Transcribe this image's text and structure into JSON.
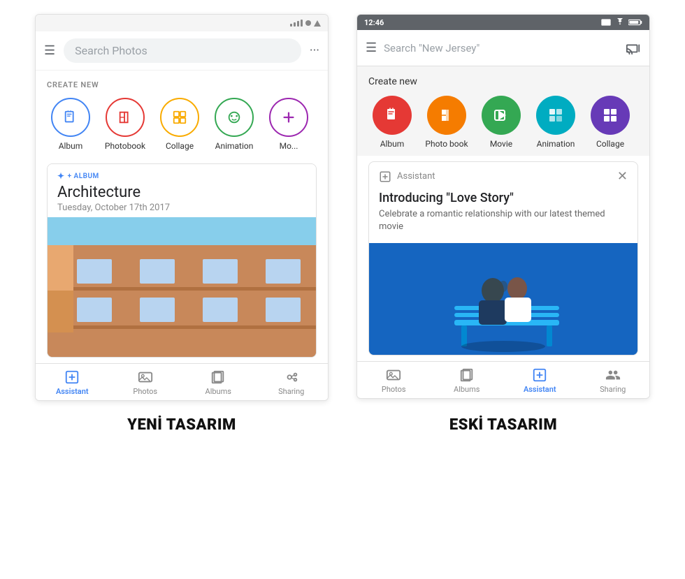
{
  "left_phone": {
    "search_placeholder": "Search Photos",
    "menu_icon": "☰",
    "more_icon": "···",
    "create_new_label": "CREATE NEW",
    "create_items": [
      {
        "id": "album",
        "label": "Album",
        "circle_style": "outline-blue",
        "icon": "🔖"
      },
      {
        "id": "photobook",
        "label": "Photobook",
        "circle_style": "outline-red",
        "icon": "📖"
      },
      {
        "id": "collage",
        "label": "Collage",
        "circle_style": "outline-yellow",
        "icon": "🖼"
      },
      {
        "id": "animation",
        "label": "Animation",
        "circle_style": "outline-green",
        "icon": "🎬"
      },
      {
        "id": "more",
        "label": "Mo...",
        "circle_style": "outline-purple",
        "icon": "⊕"
      }
    ],
    "album": {
      "tag": "+ ALBUM",
      "title": "Architecture",
      "date": "Tuesday, October 17th 2017"
    },
    "bottom_nav": [
      {
        "id": "assistant",
        "label": "Assistant",
        "active": true
      },
      {
        "id": "photos",
        "label": "Photos",
        "active": false
      },
      {
        "id": "albums",
        "label": "Albums",
        "active": false
      },
      {
        "id": "sharing",
        "label": "Sharing",
        "active": false
      }
    ]
  },
  "right_phone": {
    "status_time": "12:46",
    "search_placeholder": "Search \"New Jersey\"",
    "menu_icon": "☰",
    "create_new_label": "Create new",
    "create_items": [
      {
        "id": "album",
        "label": "Album",
        "circle_style": "filled-red",
        "icon": "🔖"
      },
      {
        "id": "photobook",
        "label": "Photo book",
        "circle_style": "filled-orange",
        "icon": "📖"
      },
      {
        "id": "movie",
        "label": "Movie",
        "circle_style": "filled-green",
        "icon": "🎬"
      },
      {
        "id": "animation",
        "label": "Animation",
        "circle_style": "filled-teal",
        "icon": "✨"
      },
      {
        "id": "collage",
        "label": "Collage",
        "circle_style": "filled-purple",
        "icon": "🖼"
      }
    ],
    "assistant_card": {
      "label": "Assistant",
      "title": "Introducing \"Love Story\"",
      "description": "Celebrate a romantic relationship with our latest themed movie"
    },
    "bottom_nav": [
      {
        "id": "photos",
        "label": "Photos",
        "active": false
      },
      {
        "id": "albums",
        "label": "Albums",
        "active": false
      },
      {
        "id": "assistant",
        "label": "Assistant",
        "active": true
      },
      {
        "id": "sharing",
        "label": "Sharing",
        "active": false
      }
    ]
  },
  "labels": {
    "left": "YENİ TASARIM",
    "right": "ESKİ TASARIM"
  }
}
